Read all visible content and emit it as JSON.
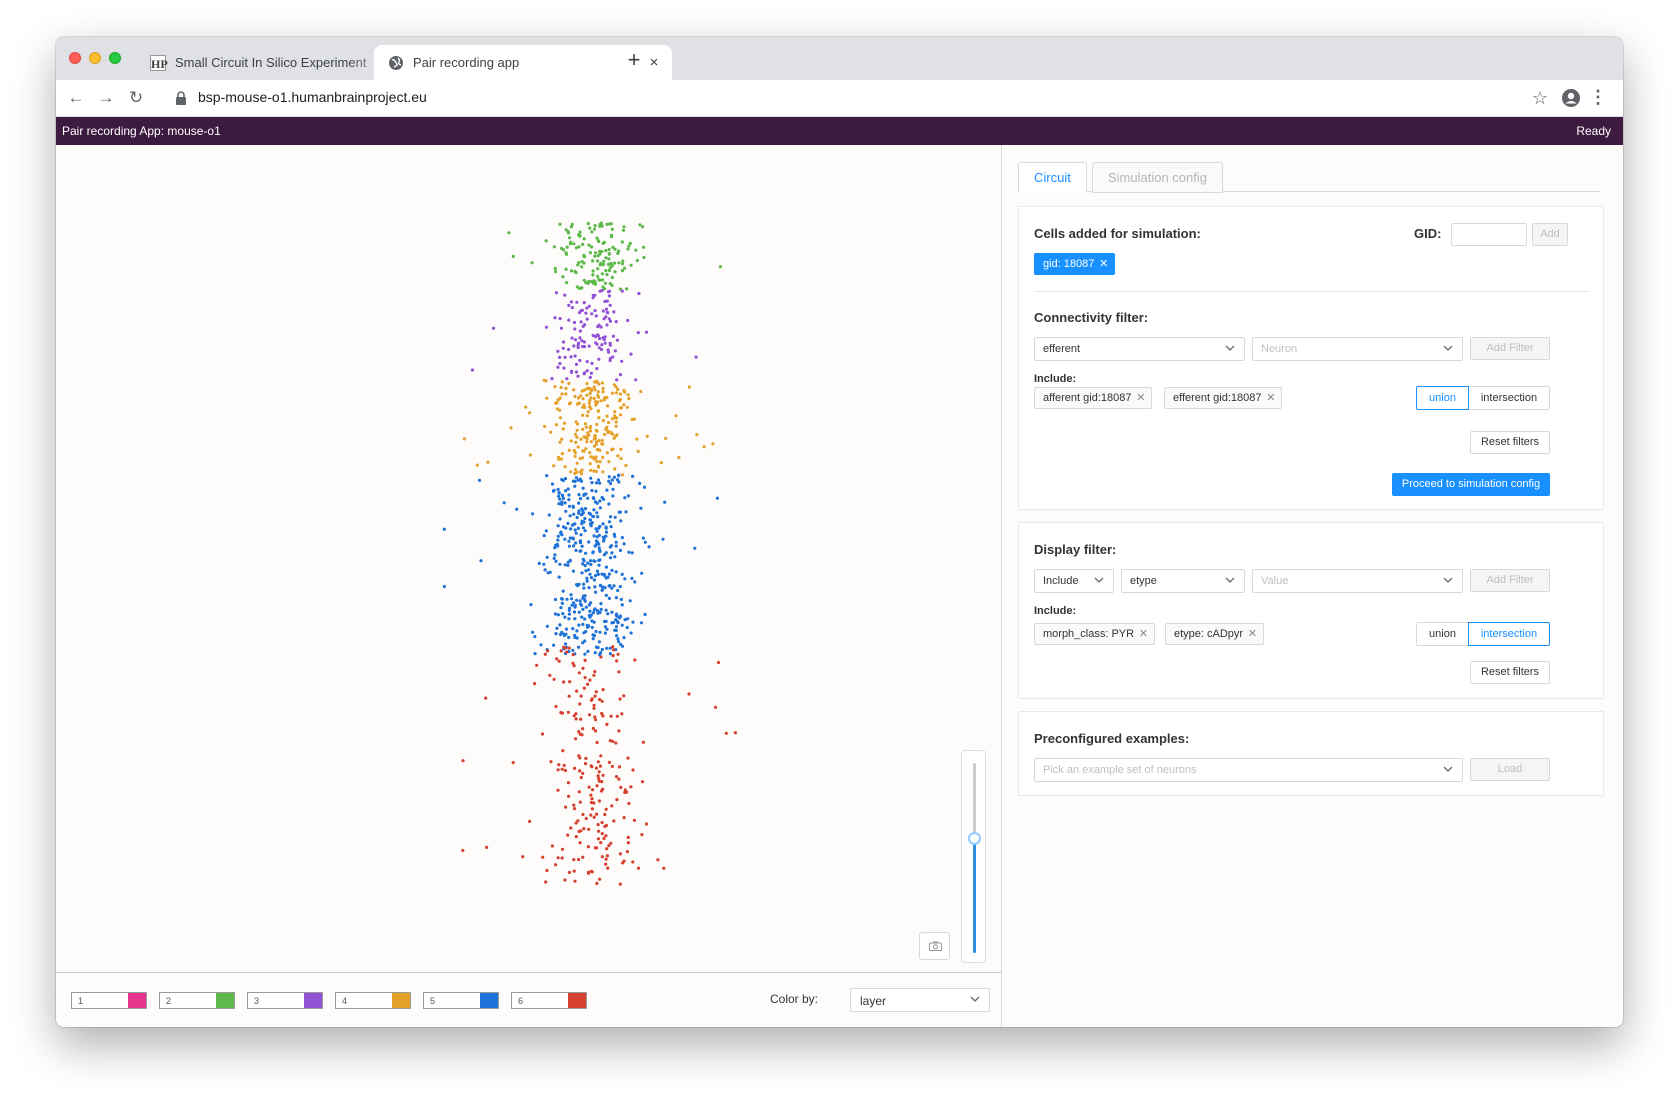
{
  "browser": {
    "tabs": [
      {
        "title": "Small Circuit In Silico Experiment",
        "favicon": "hbp-icon",
        "close": "×"
      },
      {
        "title": "Pair recording app",
        "favicon": "globe-icon",
        "close": "×"
      }
    ],
    "new_tab": "+",
    "url": "bsp-mouse-o1.humanbrainproject.eu",
    "nav": {
      "back": "←",
      "forward": "→",
      "reload": "↻",
      "bookmark": "☆",
      "menu": "⋮"
    }
  },
  "app": {
    "title": "Pair recording App: mouse-o1",
    "status": "Ready"
  },
  "viewer": {
    "legend": [
      {
        "label": "1",
        "color": "#e6358c"
      },
      {
        "label": "2",
        "color": "#5cb94a"
      },
      {
        "label": "3",
        "color": "#9352d6"
      },
      {
        "label": "4",
        "color": "#e4a12a"
      },
      {
        "label": "5",
        "color": "#1f72d8"
      },
      {
        "label": "6",
        "color": "#d6412f"
      }
    ],
    "color_by_label": "Color by:",
    "color_by_value": "layer",
    "slider_level": 0.6
  },
  "panel": {
    "tabs": [
      {
        "label": "Circuit",
        "active": true
      },
      {
        "label": "Simulation config",
        "active": false
      }
    ],
    "cells": {
      "title": "Cells added for simulation:",
      "gid_label": "GID:",
      "gid_value": "",
      "add_button": "Add",
      "tags": [
        "gid: 18087"
      ]
    },
    "connectivity": {
      "title": "Connectivity filter:",
      "direction": "efferent",
      "type_placeholder": "Neuron",
      "add_filter": "Add Filter",
      "include_label": "Include:",
      "tags": [
        "afferent gid:18087",
        "efferent gid:18087"
      ],
      "mode": [
        "union",
        "intersection"
      ],
      "mode_selected": "union",
      "reset": "Reset filters",
      "proceed": "Proceed to simulation config"
    },
    "display": {
      "title": "Display filter:",
      "include_select": "Include",
      "property_select": "etype",
      "value_placeholder": "Value",
      "add_filter": "Add Filter",
      "include_label": "Include:",
      "tags": [
        "morph_class: PYR",
        "etype: cADpyr"
      ],
      "mode": [
        "union",
        "intersection"
      ],
      "mode_selected": "intersection",
      "reset": "Reset filters"
    },
    "examples": {
      "title": "Preconfigured examples:",
      "placeholder": "Pick an example set of neurons",
      "load": "Load"
    }
  }
}
